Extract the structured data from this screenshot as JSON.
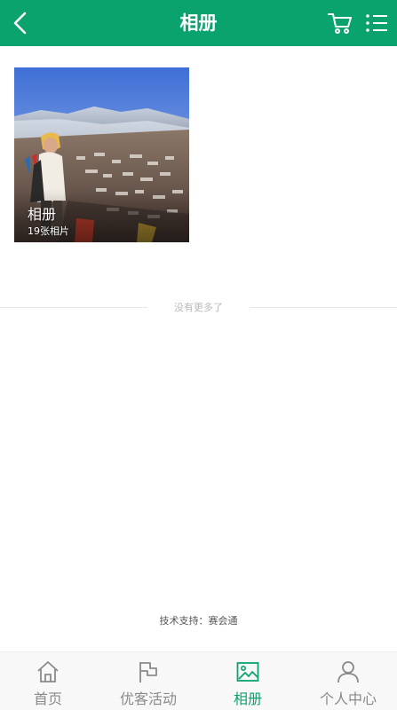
{
  "header": {
    "title": "相册",
    "back_icon": "chevron-left-icon",
    "cart_icon": "shopping-cart-icon",
    "menu_icon": "list-menu-icon",
    "background": "#0aa36e"
  },
  "albums": [
    {
      "name": "相册",
      "count_text": "19张相片"
    }
  ],
  "list_end_text": "没有更多了",
  "footer": {
    "tech_support": "技术支持：赛会通"
  },
  "tabbar": {
    "active_color": "#0aa36e",
    "inactive_color": "#8a8a8a",
    "items": [
      {
        "label": "首页",
        "icon": "home-icon",
        "active": false
      },
      {
        "label": "优客活动",
        "icon": "flag-icon",
        "active": false
      },
      {
        "label": "相册",
        "icon": "image-icon",
        "active": true
      },
      {
        "label": "个人中心",
        "icon": "user-icon",
        "active": false
      }
    ]
  }
}
